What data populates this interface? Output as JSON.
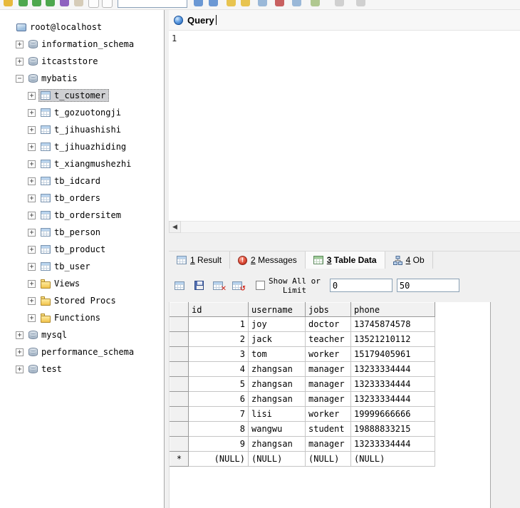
{
  "colors": {
    "selection": "#cfd0d3",
    "accent_blue": "#1b5cae",
    "error_red": "#d12417"
  },
  "tree": {
    "items": [
      {
        "label": "root@localhost",
        "level": 0,
        "icon": "server-icon",
        "expander": "none",
        "selected": false
      },
      {
        "label": "information_schema",
        "level": 1,
        "icon": "database-icon",
        "expander": "plus",
        "selected": false
      },
      {
        "label": "itcaststore",
        "level": 1,
        "icon": "database-icon",
        "expander": "plus",
        "selected": false
      },
      {
        "label": "mybatis",
        "level": 1,
        "icon": "database-icon",
        "expander": "minus",
        "selected": false
      },
      {
        "label": "t_customer",
        "level": 2,
        "icon": "table-icon",
        "expander": "plus",
        "selected": true
      },
      {
        "label": "t_gozuotongji",
        "level": 2,
        "icon": "table-icon",
        "expander": "plus",
        "selected": false
      },
      {
        "label": "t_jihuashishi",
        "level": 2,
        "icon": "table-icon",
        "expander": "plus",
        "selected": false
      },
      {
        "label": "t_jihuazhiding",
        "level": 2,
        "icon": "table-icon",
        "expander": "plus",
        "selected": false
      },
      {
        "label": "t_xiangmushezhi",
        "level": 2,
        "icon": "table-icon",
        "expander": "plus",
        "selected": false
      },
      {
        "label": "tb_idcard",
        "level": 2,
        "icon": "table-icon",
        "expander": "plus",
        "selected": false
      },
      {
        "label": "tb_orders",
        "level": 2,
        "icon": "table-icon",
        "expander": "plus",
        "selected": false
      },
      {
        "label": "tb_ordersitem",
        "level": 2,
        "icon": "table-icon",
        "expander": "plus",
        "selected": false
      },
      {
        "label": "tb_person",
        "level": 2,
        "icon": "table-icon",
        "expander": "plus",
        "selected": false
      },
      {
        "label": "tb_product",
        "level": 2,
        "icon": "table-icon",
        "expander": "plus",
        "selected": false
      },
      {
        "label": "tb_user",
        "level": 2,
        "icon": "table-icon",
        "expander": "plus",
        "selected": false
      },
      {
        "label": "Views",
        "level": 2,
        "icon": "folder-icon",
        "expander": "plus",
        "selected": false
      },
      {
        "label": "Stored Procs",
        "level": 2,
        "icon": "folder-icon",
        "expander": "plus",
        "selected": false
      },
      {
        "label": "Functions",
        "level": 2,
        "icon": "folder-icon",
        "expander": "plus",
        "selected": false
      },
      {
        "label": "mysql",
        "level": 1,
        "icon": "database-icon",
        "expander": "plus",
        "selected": false
      },
      {
        "label": "performance_schema",
        "level": 1,
        "icon": "database-icon",
        "expander": "plus",
        "selected": false
      },
      {
        "label": "test",
        "level": 1,
        "icon": "database-icon",
        "expander": "plus",
        "selected": false
      }
    ]
  },
  "query": {
    "tab_label": "Query",
    "icon": "query-orb-icon",
    "line_number": "1",
    "content": ""
  },
  "result_tabs": [
    {
      "num": "1",
      "text": " Result",
      "icon": "result-grid-icon",
      "active": false
    },
    {
      "num": "2",
      "text": " Messages",
      "icon": "messages-icon",
      "active": false
    },
    {
      "num": "3",
      "text": " Table Data",
      "icon": "table-data-icon",
      "active": true
    },
    {
      "num": "4",
      "text": " Ob",
      "icon": "objects-icon",
      "active": false
    }
  ],
  "table_toolbar": {
    "buttons": [
      {
        "icon": "insert-row-icon"
      },
      {
        "icon": "save-changes-icon"
      },
      {
        "icon": "delete-row-icon"
      },
      {
        "icon": "revert-changes-icon"
      }
    ],
    "show_all_label": "Show All or",
    "limit_label": "Limit",
    "checkbox_checked": false,
    "offset_value": "0",
    "limit_value": "50"
  },
  "data_grid": {
    "columns": [
      "id",
      "username",
      "jobs",
      "phone"
    ],
    "new_row_marker": "*",
    "rows": [
      {
        "marker": "",
        "cells": [
          "1",
          "joy",
          "doctor",
          "13745874578"
        ]
      },
      {
        "marker": "",
        "cells": [
          "2",
          "jack",
          "teacher",
          "13521210112"
        ]
      },
      {
        "marker": "",
        "cells": [
          "3",
          "tom",
          "worker",
          "15179405961"
        ]
      },
      {
        "marker": "",
        "cells": [
          "4",
          "zhangsan",
          "manager",
          "13233334444"
        ]
      },
      {
        "marker": "",
        "cells": [
          "5",
          "zhangsan",
          "manager",
          "13233334444"
        ]
      },
      {
        "marker": "",
        "cells": [
          "6",
          "zhangsan",
          "manager",
          "13233334444"
        ]
      },
      {
        "marker": "",
        "cells": [
          "7",
          "lisi",
          "worker",
          "19999666666"
        ]
      },
      {
        "marker": "",
        "cells": [
          "8",
          "wangwu",
          "student",
          "19888833215"
        ]
      },
      {
        "marker": "*",
        "cells": [
          "9",
          "zhangsan",
          "manager",
          "13233334444"
        ],
        "marker_note": ""
      },
      {
        "marker": "*",
        "cells": [
          "(NULL)",
          "(NULL)",
          "(NULL)",
          "(NULL)"
        ]
      }
    ]
  }
}
